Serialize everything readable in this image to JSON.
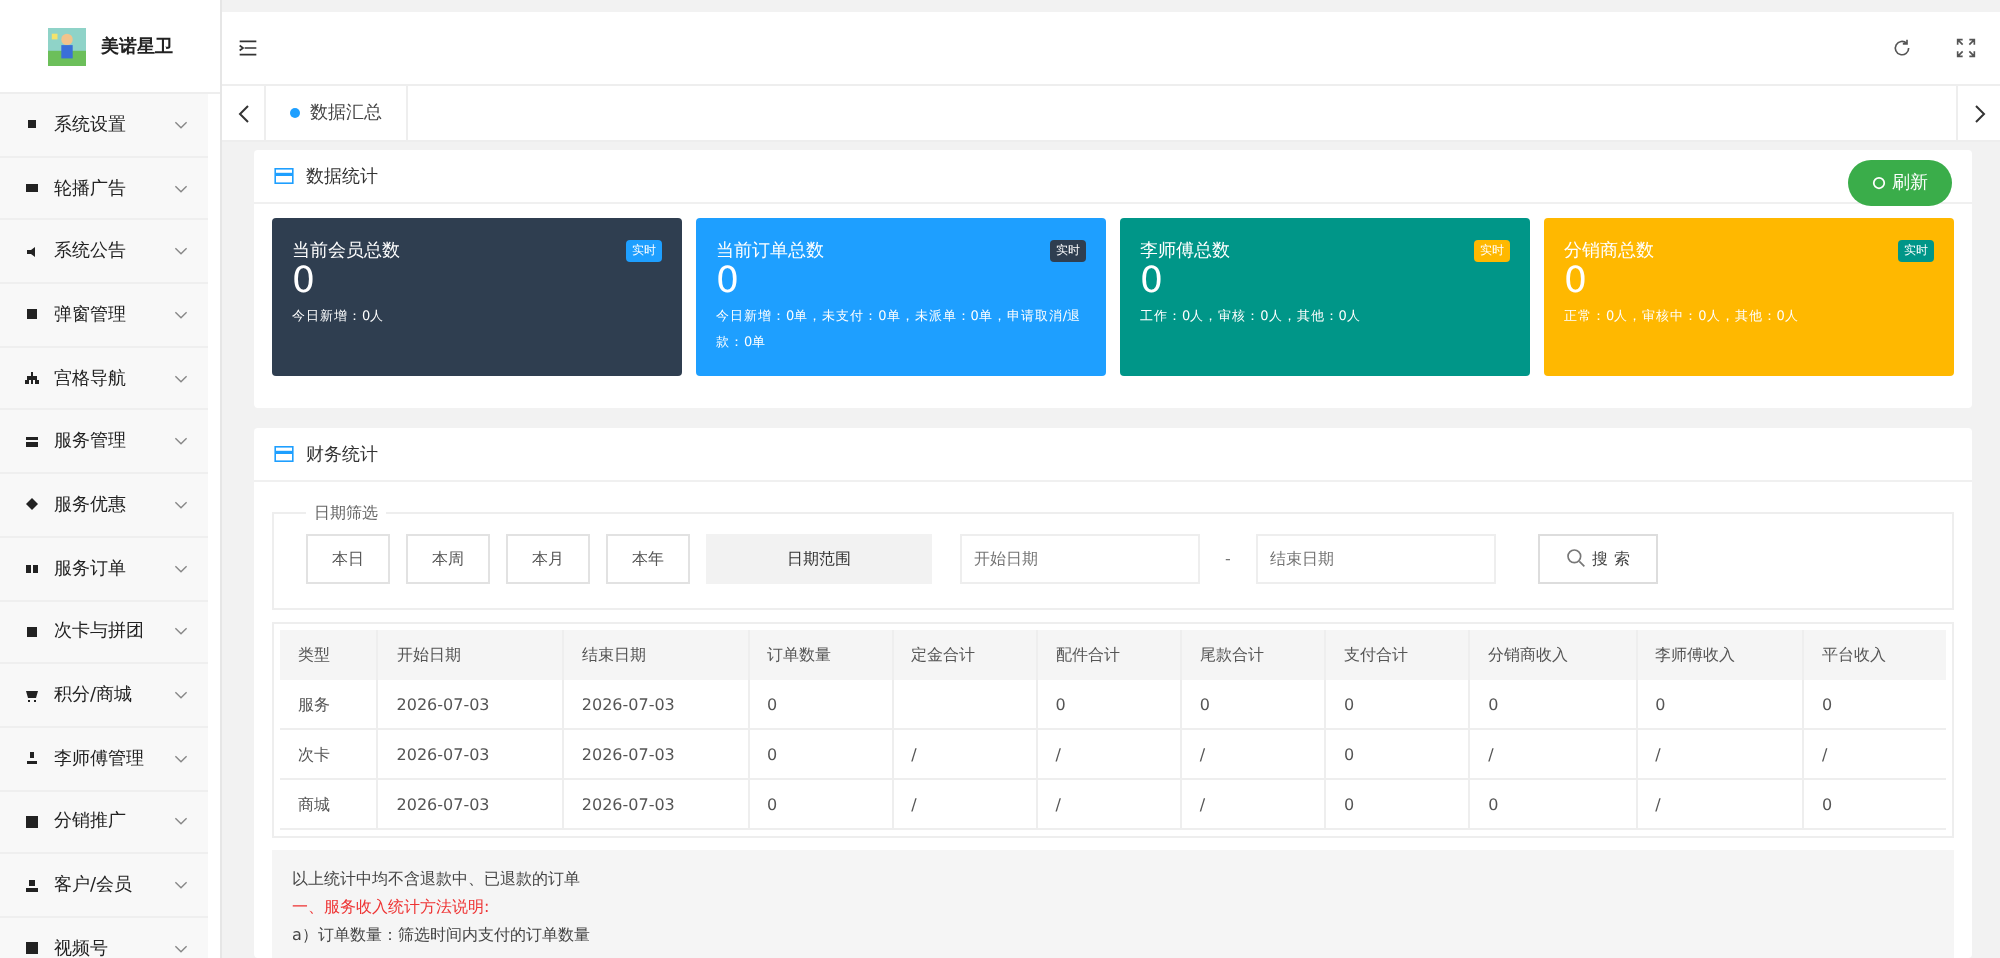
{
  "sidebar": {
    "brand": "美诺星卫",
    "items": [
      {
        "label": "系统设置",
        "expanded": false
      },
      {
        "label": "轮播广告",
        "expanded": false
      },
      {
        "label": "系统公告",
        "expanded": false
      },
      {
        "label": "弹窗管理",
        "expanded": false
      },
      {
        "label": "宫格导航",
        "expanded": false
      },
      {
        "label": "服务管理",
        "expanded": false
      },
      {
        "label": "服务优惠",
        "expanded": false
      },
      {
        "label": "服务订单",
        "expanded": false
      },
      {
        "label": "次卡与拼团",
        "expanded": false
      },
      {
        "label": "积分/商城",
        "expanded": false
      },
      {
        "label": "李师傅管理",
        "expanded": false
      },
      {
        "label": "分销推广",
        "expanded": false
      },
      {
        "label": "客户/会员",
        "expanded": false
      },
      {
        "label": "视频号",
        "expanded": false
      }
    ]
  },
  "tabs": [
    {
      "label": "数据汇总",
      "selected": true
    }
  ],
  "data_stats": {
    "title": "数据统计",
    "refresh_button": "刷新",
    "cards": [
      {
        "title": "当前会员总数",
        "badge": {
          "label": "实时",
          "color": "#1e9fff"
        },
        "value": "0",
        "detail": "今日新增：0人",
        "color": "#2f3e50"
      },
      {
        "title": "当前订单总数",
        "badge": {
          "label": "实时",
          "color": "#2f3e50"
        },
        "value": "0",
        "detail": "今日新增：0单，未支付：0单，未派单：0单，申请取消/退款：0单",
        "color": "#1e9fff"
      },
      {
        "title": "李师傅总数",
        "badge": {
          "label": "实时",
          "color": "#ffb800"
        },
        "value": "0",
        "detail": "工作：0人，审核：0人，其他：0人",
        "color": "#009688"
      },
      {
        "title": "分销商总数",
        "badge": {
          "label": "实时",
          "color": "#009688"
        },
        "value": "0",
        "detail": "正常：0人，审核中：0人，其他：0人",
        "color": "#ffb800"
      }
    ]
  },
  "finance": {
    "title": "财务统计",
    "filter": {
      "legend": "日期筛选",
      "quick_buttons": [
        "本日",
        "本周",
        "本月",
        "本年"
      ],
      "range_label": "日期范围",
      "start": {
        "placeholder": "开始日期"
      },
      "separator": "-",
      "end": {
        "placeholder": "结束日期"
      },
      "search_button": "搜 索"
    },
    "table": {
      "columns": [
        "类型",
        "开始日期",
        "结束日期",
        "订单数量",
        "定金合计",
        "配件合计",
        "尾款合计",
        "支付合计",
        "分销商收入",
        "李师傅收入",
        "平台收入"
      ],
      "rows": [
        [
          "服务",
          "2026-07-03",
          "2026-07-03",
          "0",
          "",
          "0",
          "0",
          "0",
          "0",
          "0",
          "0"
        ],
        [
          "次卡",
          "2026-07-03",
          "2026-07-03",
          "0",
          "/",
          "/",
          "/",
          "0",
          "/",
          "/",
          "/"
        ],
        [
          "商城",
          "2026-07-03",
          "2026-07-03",
          "0",
          "/",
          "/",
          "/",
          "0",
          "0",
          "/",
          "0"
        ]
      ]
    },
    "notes": [
      {
        "text": "以上统计中均不含退款中、已退款的订单",
        "kind": "plain"
      },
      {
        "text": "一、服务收入统计方法说明:",
        "kind": "heading"
      },
      {
        "text": "a）订单数量：筛选时间内支付的订单数量",
        "kind": "plain"
      }
    ]
  }
}
